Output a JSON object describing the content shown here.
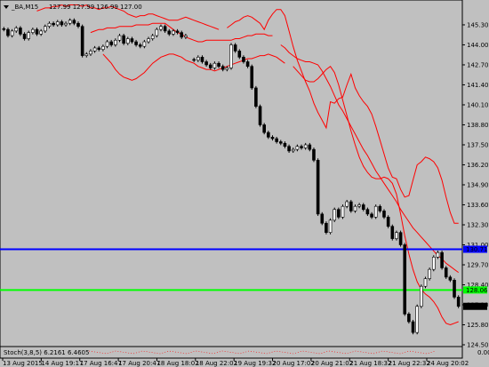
{
  "header": {
    "symbol_label": "_BA,M15",
    "ohlc_label": "127.99 127.99 126.99 127.00"
  },
  "colors": {
    "background": "#c0c0c0",
    "band": "#ff0000",
    "blue_level": "#0000ff",
    "green_level": "#00ff00",
    "price_bg": "#000000"
  },
  "chart_data": {
    "type": "candlestick",
    "title": "",
    "ylim": [
      124.5,
      146.8
    ],
    "y_ticks": [
      145.3,
      144.0,
      142.7,
      141.4,
      140.1,
      138.8,
      137.5,
      136.2,
      134.9,
      133.6,
      132.3,
      131.0,
      129.7,
      128.4,
      127.1,
      125.8,
      124.5
    ],
    "x_labels": [
      "13 Aug 2015",
      "14 Aug 19:17",
      "17 Aug 16:47",
      "17 Aug 20:47",
      "18 Aug 18:02",
      "18 Aug 22:02",
      "19 Aug 19:32",
      "20 Aug 17:02",
      "20 Aug 21:02",
      "21 Aug 18:32",
      "21 Aug 22:32",
      "24 Aug 20:02"
    ],
    "levels": [
      {
        "price": 130.71,
        "label": "130.71",
        "color": "#0000ff"
      },
      {
        "price": 128.06,
        "label": "128.06",
        "color": "#00ff00"
      }
    ],
    "current_price": {
      "price": 127.0,
      "label": "127.00"
    },
    "close_series": [
      145.0,
      144.6,
      144.9,
      145.1,
      144.7,
      144.4,
      144.8,
      145.0,
      144.7,
      144.9,
      145.2,
      145.4,
      145.3,
      145.5,
      145.3,
      145.4,
      145.6,
      145.4,
      145.2,
      143.3,
      143.4,
      143.6,
      143.8,
      143.7,
      143.9,
      144.2,
      144.0,
      144.3,
      144.6,
      144.1,
      144.4,
      144.2,
      144.0,
      143.9,
      144.2,
      144.4,
      144.6,
      145.0,
      145.2,
      144.9,
      144.7,
      144.9,
      144.8,
      144.5,
      144.6,
      null,
      143.0,
      143.2,
      142.9,
      142.7,
      142.5,
      142.8,
      142.6,
      142.4,
      142.5,
      144.0,
      143.6,
      143.2,
      142.9,
      142.6,
      141.2,
      140.0,
      138.8,
      138.3,
      138.0,
      137.9,
      137.7,
      137.6,
      137.4,
      137.1,
      137.2,
      137.4,
      137.3,
      137.5,
      137.2,
      136.5,
      133.0,
      132.4,
      131.8,
      132.6,
      133.3,
      132.8,
      133.5,
      133.8,
      133.2,
      133.5,
      133.6,
      133.3,
      133.0,
      132.8,
      133.5,
      133.2,
      132.8,
      132.2,
      131.4,
      131.8,
      131.0,
      126.5,
      126.0,
      125.3,
      127.0,
      128.3,
      128.8,
      129.4,
      130.2,
      130.5,
      129.5,
      128.9,
      128.7,
      127.6,
      127.0
    ],
    "bands": {
      "upper": [
        146.2,
        146.3,
        146.4,
        146.4,
        146.5,
        146.5,
        146.6,
        146.5,
        146.6,
        146.6,
        146.6,
        146.5,
        146.6,
        146.4,
        146.4,
        146.3,
        146.4,
        146.4,
        146.5,
        146.4,
        146.3,
        146.2,
        146.0,
        145.9,
        145.8,
        145.9,
        145.9,
        146.0,
        146.0,
        145.9,
        145.8,
        145.7,
        145.6,
        145.6,
        145.6,
        145.7,
        145.8,
        145.7,
        145.6,
        145.5,
        145.4,
        145.3,
        145.2,
        145.1,
        145.0,
        null,
        145.1,
        145.3,
        145.5,
        145.6,
        145.8,
        145.9,
        145.8,
        145.6,
        145.4,
        145.0,
        145.6,
        146.0,
        146.3,
        146.3,
        145.9,
        144.9,
        143.9,
        143.0,
        142.3,
        141.6,
        141.0,
        140.2,
        139.6,
        139.1,
        138.6,
        140.3,
        140.2,
        140.5,
        140.6,
        141.4,
        142.1,
        141.2,
        140.7,
        140.3,
        140.0,
        139.5,
        138.7,
        137.8,
        136.9,
        136.0,
        135.4,
        135.3,
        134.6,
        134.1,
        134.2,
        135.2,
        136.2,
        136.4,
        136.7,
        136.6,
        136.4,
        136.0,
        135.2,
        134.1,
        133.1,
        132.4,
        132.4
      ],
      "middle": [
        144.8,
        144.9,
        145.0,
        145.0,
        145.1,
        145.1,
        145.1,
        145.2,
        145.2,
        145.2,
        145.2,
        145.3,
        145.3,
        145.3,
        145.3,
        145.4,
        145.4,
        145.4,
        145.4,
        145.2,
        145.0,
        144.8,
        144.7,
        144.5,
        144.4,
        144.3,
        144.2,
        144.2,
        144.3,
        144.3,
        144.3,
        144.3,
        144.3,
        144.3,
        144.3,
        144.4,
        144.4,
        144.5,
        144.6,
        144.6,
        144.7,
        144.7,
        144.7,
        144.6,
        144.6,
        null,
        144.0,
        143.8,
        143.5,
        143.3,
        143.1,
        143.0,
        142.9,
        142.9,
        142.8,
        142.7,
        142.3,
        141.8,
        141.3,
        140.7,
        140.1,
        139.7,
        139.2,
        138.7,
        138.2,
        137.7,
        137.2,
        136.8,
        136.3,
        135.8,
        135.4,
        135.0,
        134.6,
        134.2,
        133.8,
        133.3,
        132.9,
        132.5,
        132.1,
        131.8,
        131.5,
        131.2,
        130.9,
        130.6,
        130.3,
        130.1,
        129.8,
        129.6,
        129.4,
        129.2
      ],
      "lower": [
        143.4,
        143.1,
        142.8,
        142.4,
        142.1,
        141.9,
        141.8,
        141.7,
        141.8,
        142.0,
        142.2,
        142.5,
        142.8,
        143.0,
        143.2,
        143.3,
        143.4,
        143.4,
        143.3,
        143.2,
        143.0,
        142.9,
        142.8,
        142.6,
        142.5,
        142.4,
        142.4,
        142.3,
        142.4,
        142.5,
        142.6,
        142.7,
        142.8,
        142.9,
        143.0,
        143.1,
        143.1,
        143.2,
        143.3,
        143.3,
        143.4,
        143.3,
        143.2,
        143.0,
        142.8,
        null,
        142.6,
        142.3,
        142.0,
        141.7,
        141.6,
        141.6,
        141.8,
        142.1,
        142.4,
        142.6,
        142.2,
        141.4,
        140.4,
        139.4,
        138.4,
        137.5,
        136.7,
        136.1,
        135.7,
        135.4,
        135.3,
        135.3,
        135.4,
        135.3,
        135.0,
        134.3,
        133.0,
        131.6,
        130.4,
        129.4,
        128.6,
        128.1,
        127.8,
        127.6,
        127.3,
        126.9,
        126.3,
        125.9,
        125.8,
        125.9,
        126.0
      ]
    }
  },
  "sub_panel": {
    "label": "Stoch(3,8,5) 6.2161 6.4605",
    "tick_label": "0.00"
  }
}
